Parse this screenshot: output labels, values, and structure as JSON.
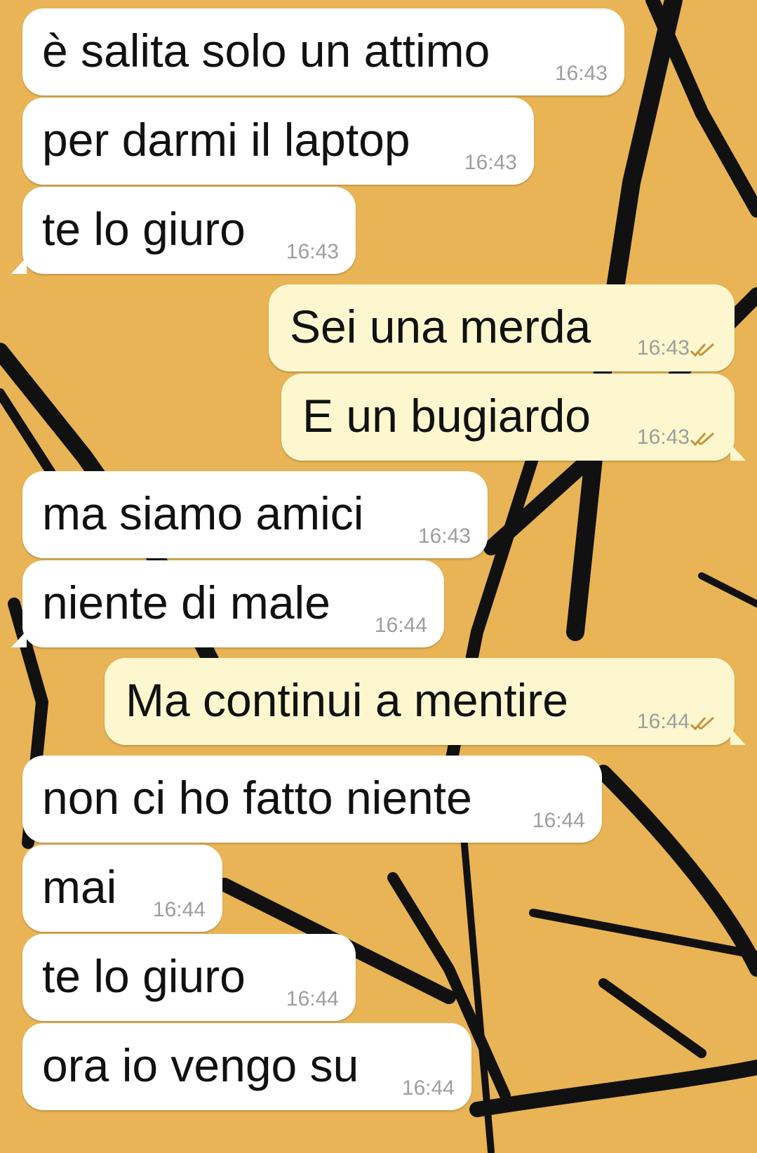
{
  "messages": [
    {
      "direction": "in",
      "text": "è salita solo un attimo",
      "time": "16:43"
    },
    {
      "direction": "in",
      "text": "per darmi il laptop",
      "time": "16:43"
    },
    {
      "direction": "in",
      "text": "te lo giuro",
      "time": "16:43"
    },
    {
      "direction": "out",
      "text": "Sei una merda",
      "time": "16:43",
      "status": "read"
    },
    {
      "direction": "out",
      "text": "E un bugiardo",
      "time": "16:43",
      "status": "read"
    },
    {
      "direction": "in",
      "text": "ma siamo amici",
      "time": "16:43"
    },
    {
      "direction": "in",
      "text": "niente di male",
      "time": "16:44"
    },
    {
      "direction": "out",
      "text": "Ma continui a mentire",
      "time": "16:44",
      "status": "read"
    },
    {
      "direction": "in",
      "text": "non ci ho fatto niente",
      "time": "16:44"
    },
    {
      "direction": "in",
      "text": "mai",
      "time": "16:44"
    },
    {
      "direction": "in",
      "text": "te lo giuro",
      "time": "16:44"
    },
    {
      "direction": "in",
      "text": "ora io vengo su",
      "time": "16:44"
    }
  ],
  "colors": {
    "wallpaper": "#e9b455",
    "incoming_bubble": "#ffffff",
    "outgoing_bubble": "#fdf7cf",
    "read_ticks": "#c8923a"
  },
  "icons": {
    "read_status": "double-check-icon",
    "wallpaper": "bicycle-sketch-wallpaper"
  }
}
